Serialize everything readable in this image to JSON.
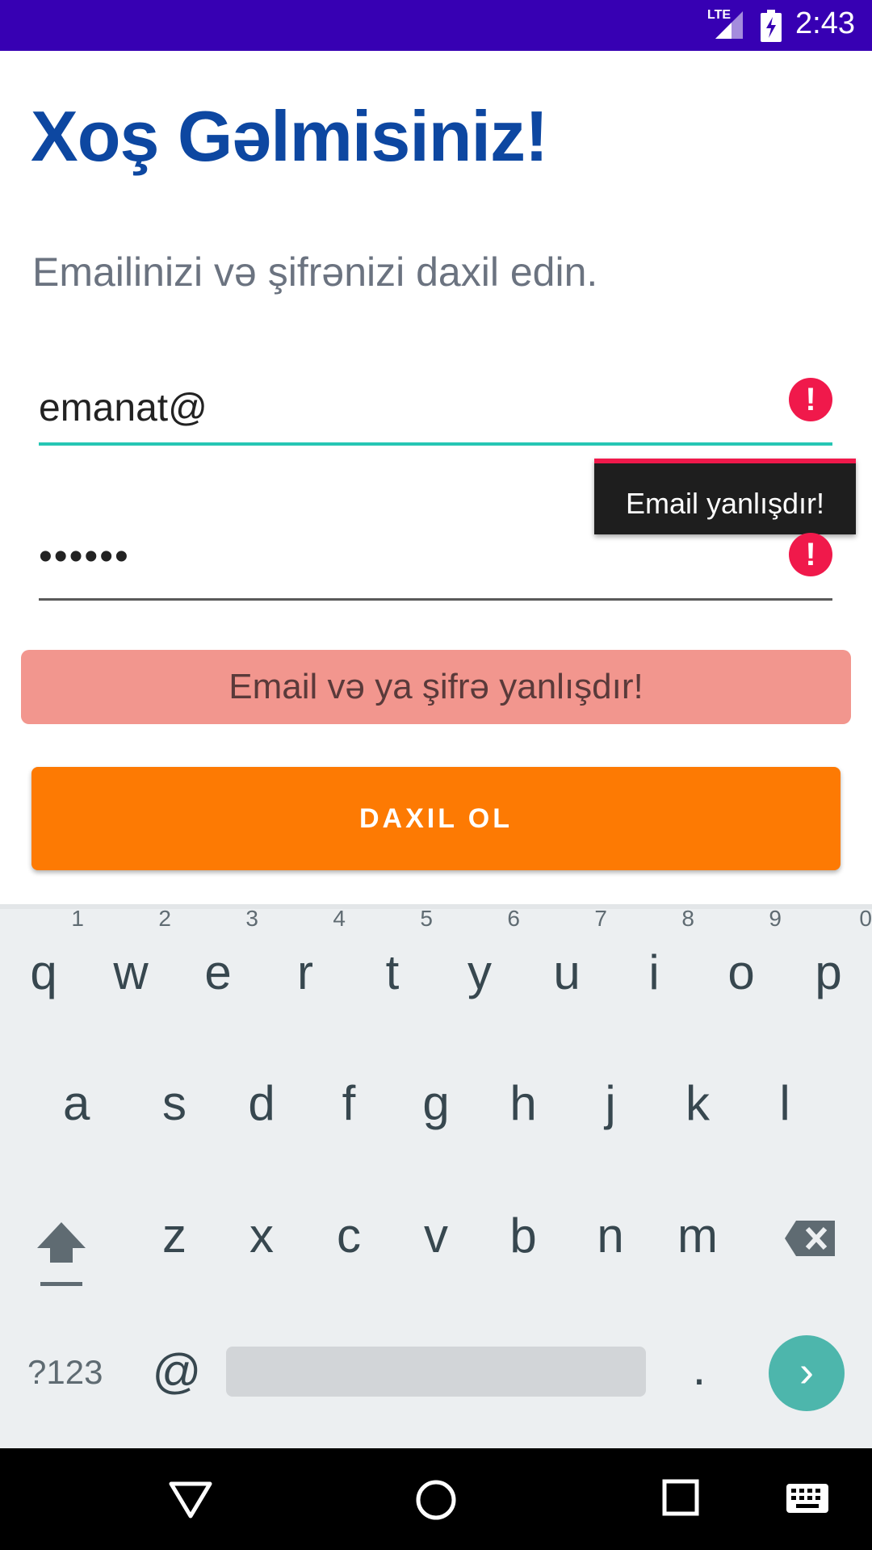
{
  "status_bar": {
    "network": "LTE",
    "time": "2:43",
    "bg_color": "#3700b3"
  },
  "screen": {
    "title": "Xoş Gəlmisiniz!",
    "subtitle": "Emailinizi və şifrənizi daxil edin.",
    "email": {
      "value": "emanat@",
      "error_icon": "!"
    },
    "password": {
      "value": "••••••",
      "error_icon": "!"
    },
    "tooltip": "Email yanlışdır!",
    "error_banner": "Email və ya şifrə yanlışdır!",
    "login_button": "DAXIL OL",
    "colors": {
      "title": "#0d47a1",
      "accent_orange": "#fd7a03",
      "error_red": "#f0194b",
      "banner_bg": "#f2968e",
      "focus_line": "#26c6b4"
    }
  },
  "keyboard": {
    "row1": [
      {
        "key": "q",
        "hint": "1"
      },
      {
        "key": "w",
        "hint": "2"
      },
      {
        "key": "e",
        "hint": "3"
      },
      {
        "key": "r",
        "hint": "4"
      },
      {
        "key": "t",
        "hint": "5"
      },
      {
        "key": "y",
        "hint": "6"
      },
      {
        "key": "u",
        "hint": "7"
      },
      {
        "key": "i",
        "hint": "8"
      },
      {
        "key": "o",
        "hint": "9"
      },
      {
        "key": "p",
        "hint": "0"
      }
    ],
    "row2": [
      "a",
      "s",
      "d",
      "f",
      "g",
      "h",
      "j",
      "k",
      "l"
    ],
    "row3": [
      "z",
      "x",
      "c",
      "v",
      "b",
      "n",
      "m"
    ],
    "symbols_key": "?123",
    "at_key": "@",
    "period_key": ".",
    "go_icon": "›"
  }
}
